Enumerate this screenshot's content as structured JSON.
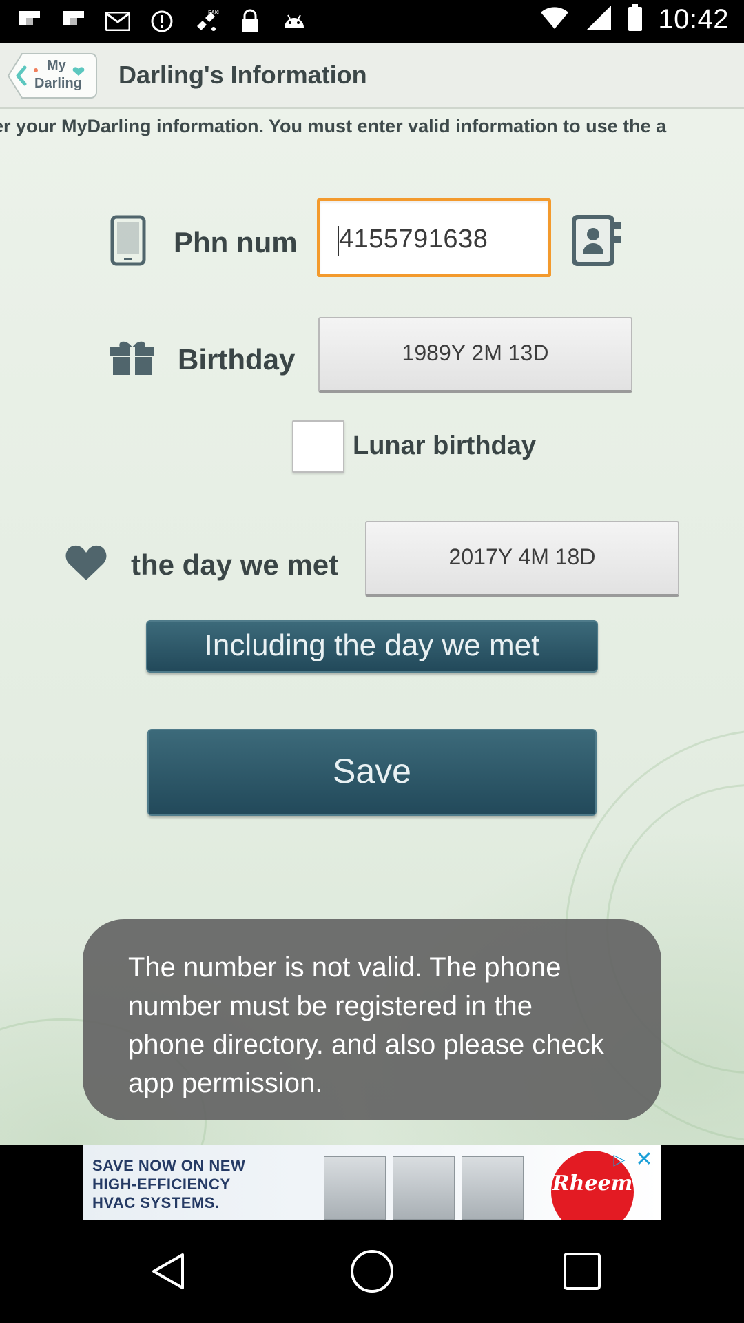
{
  "status_bar": {
    "time": "10:42",
    "left_icons": [
      "flipboard-icon",
      "flipboard-icon",
      "gmail-icon",
      "alert-icon",
      "fake-gps-icon",
      "lock-icon",
      "android-icon"
    ]
  },
  "header": {
    "back_label_line1": "My",
    "back_label_line2": "Darling",
    "title": "Darling's Information"
  },
  "marquee": "er your MyDarling information. You must enter valid information to use the a",
  "form": {
    "phone_label": "Phn num",
    "phone_value": "4155791638",
    "birthday_label": "Birthday",
    "birthday_value": "1989Y 2M 13D",
    "lunar_label": "Lunar birthday",
    "lunar_checked": false,
    "met_label": "the day we met",
    "met_value": "2017Y 4M 18D",
    "including_button": "Including the day we met",
    "save_button": "Save"
  },
  "toast": "The number is not valid. The phone number must be registered in the phone directory. and also please check app permission.",
  "ad": {
    "line1": "SAVE NOW ON NEW",
    "line2": "HIGH-EFFICIENCY",
    "line3": "HVAC SYSTEMS.",
    "brand": "Rheem"
  },
  "colors": {
    "accent_orange": "#f39a2d",
    "button_dark": "#22495a",
    "header_bg": "#ebeee9"
  }
}
